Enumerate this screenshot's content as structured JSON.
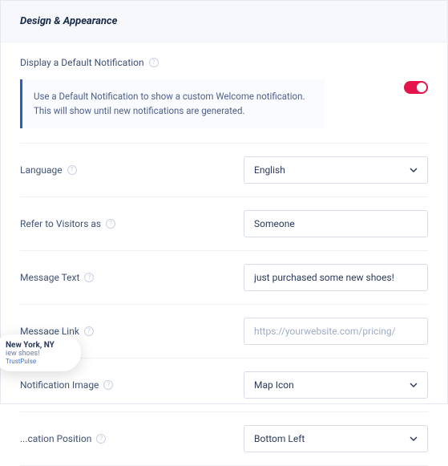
{
  "header": {
    "title": "Design & Appearance"
  },
  "defaultNotification": {
    "label": "Display a Default Notification",
    "description": "Use a Default Notification to show a custom Welcome notification. This will show until new notifications are generated.",
    "enabled": true
  },
  "fields": {
    "language": {
      "label": "Language",
      "value": "English"
    },
    "referVisitors": {
      "label": "Refer to Visitors as",
      "value": "Someone"
    },
    "messageText": {
      "label": "Message Text",
      "value": "just purchased some new shoes!"
    },
    "messageLink": {
      "label": "Message Link",
      "value": "",
      "placeholder": "https://yourwebsite.com/pricing/"
    },
    "notificationImage": {
      "label": "Notification Image",
      "value": "Map Icon"
    },
    "notificationPosition": {
      "label": "Notification Position",
      "value": "Bottom Left"
    }
  },
  "preview": {
    "location": "New York, NY",
    "action": "just purchased some new shoes!",
    "brand": "TrustPulse"
  },
  "notificationPositionDisplayLabel": "...cation Position"
}
